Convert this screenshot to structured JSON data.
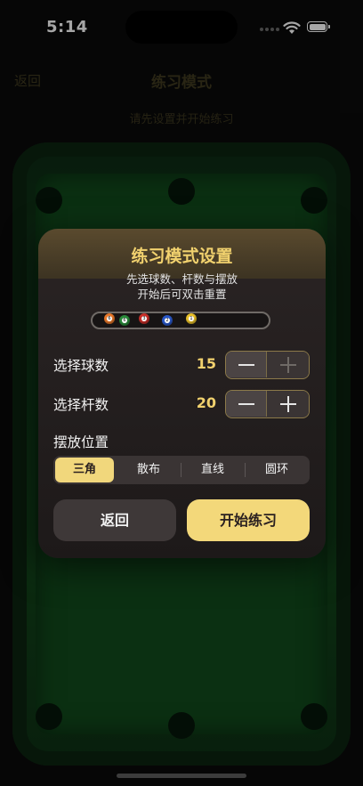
{
  "status_bar": {
    "time": "5:14"
  },
  "background": {
    "back_label": "返回",
    "title": "练习模式",
    "subtitle": "请先设置并开始练习"
  },
  "modal": {
    "title": "练习模式设置",
    "desc_line1": "先选球数、杆数与摆放",
    "desc_line2": "开始后可双击重置",
    "balls": [
      {
        "color": "#e8782a",
        "num": "6"
      },
      {
        "color": "#2a8a3a",
        "num": "6"
      },
      {
        "color": "#c8302a",
        "num": "3"
      },
      {
        "color": "#2a58c8",
        "num": "2"
      },
      {
        "color": "#e8c02a",
        "num": "1"
      }
    ],
    "ball_count": {
      "label": "选择球数",
      "value": "15"
    },
    "cue_count": {
      "label": "选择杆数",
      "value": "20"
    },
    "placement": {
      "label": "摆放位置",
      "options": [
        "三角",
        "散布",
        "直线",
        "圆环"
      ],
      "selected": "三角"
    },
    "back_button": "返回",
    "start_button": "开始练习"
  },
  "colors": {
    "accent": "#f1d16e",
    "start_button": "#f3d87a",
    "modal_bg": "#1d1919",
    "felt": "#114a1c"
  }
}
